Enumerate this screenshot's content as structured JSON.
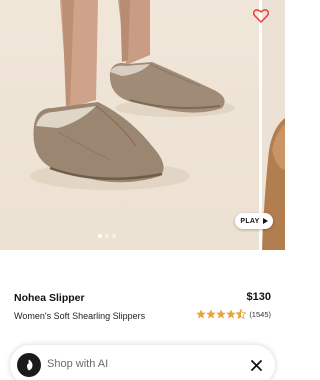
{
  "gallery": {
    "play_label": "PLAY",
    "slide_count": 3,
    "active_slide": 1
  },
  "product": {
    "name": "Nohea Slipper",
    "price": "$130",
    "subtitle": "Women's Soft Shearling Slippers",
    "rating": 4.5,
    "review_count": "(1545)"
  },
  "shop_ai": {
    "placeholder": "Shop with AI"
  },
  "icons": {
    "wishlist": "heart-icon",
    "play": "play-icon",
    "ai": "shop-ai-icon",
    "close": "close-icon",
    "star": "star-icon"
  },
  "colors": {
    "heart": "#e2453f",
    "star": "#e8a33d",
    "suede": "#9b8672",
    "background": "#efe4d6"
  }
}
